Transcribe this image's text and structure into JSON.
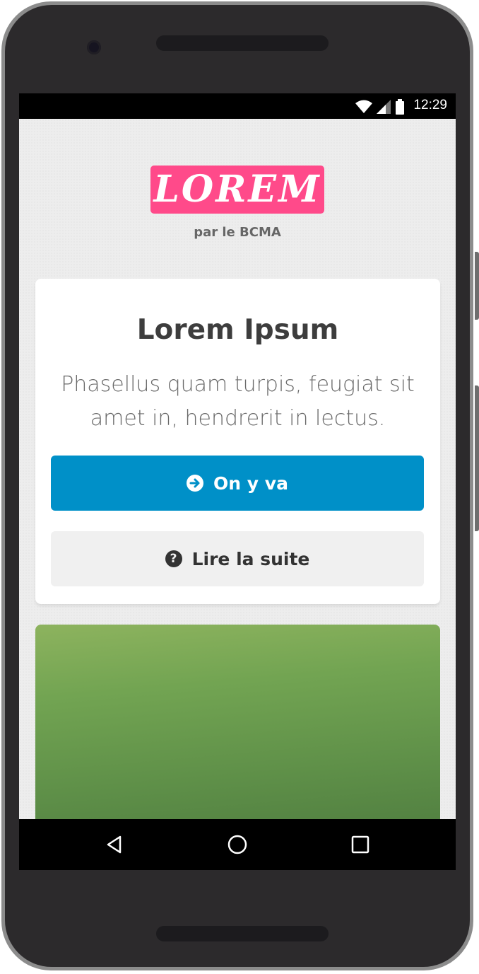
{
  "status_bar": {
    "time": "12:29",
    "icons": [
      "wifi-icon",
      "cell-signal-icon",
      "battery-icon"
    ]
  },
  "header": {
    "logo_text": "LOREM",
    "tagline": "par le BCMA"
  },
  "card": {
    "title": "Lorem Ipsum",
    "text": "Phasellus quam turpis, feugiat sit amet in, hendrerit in lectus.",
    "primary_button": {
      "label": "On y va",
      "icon": "arrow-circle-right-icon"
    },
    "secondary_button": {
      "label": "Lire la suite",
      "icon": "question-circle-icon"
    }
  },
  "nav_bar": {
    "buttons": [
      "back-icon",
      "home-icon",
      "recents-icon"
    ]
  },
  "colors": {
    "accent_pink": "#ff4a8a",
    "primary_blue": "#0090c8",
    "background": "#ededed"
  }
}
